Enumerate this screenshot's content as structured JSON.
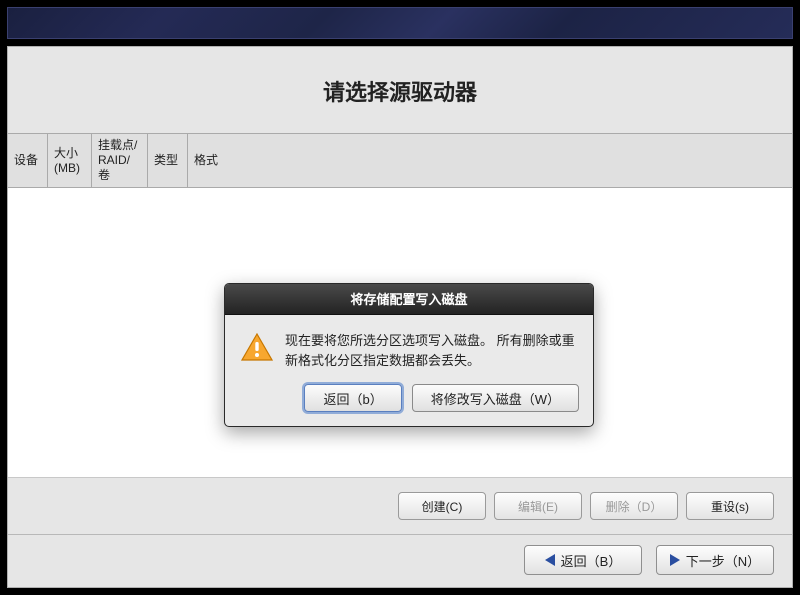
{
  "page": {
    "title": "请选择源驱动器"
  },
  "table": {
    "headers": {
      "device": "设备",
      "size": "大小\n(MB)",
      "mount": "挂载点/\nRAID/卷",
      "type": "类型",
      "format": "格式"
    }
  },
  "actions": {
    "create": "创建(C)",
    "edit": "编辑(E)",
    "delete": "删除（D）",
    "reset": "重设(s)"
  },
  "nav": {
    "back": "返回（B）",
    "next": "下一步（N）"
  },
  "modal": {
    "title": "将存储配置写入磁盘",
    "message": "现在要将您所选分区选项写入磁盘。  所有删除或重新格式化分区指定数据都会丢失。",
    "back": "返回（b）",
    "write": "将修改写入磁盘（W）"
  }
}
